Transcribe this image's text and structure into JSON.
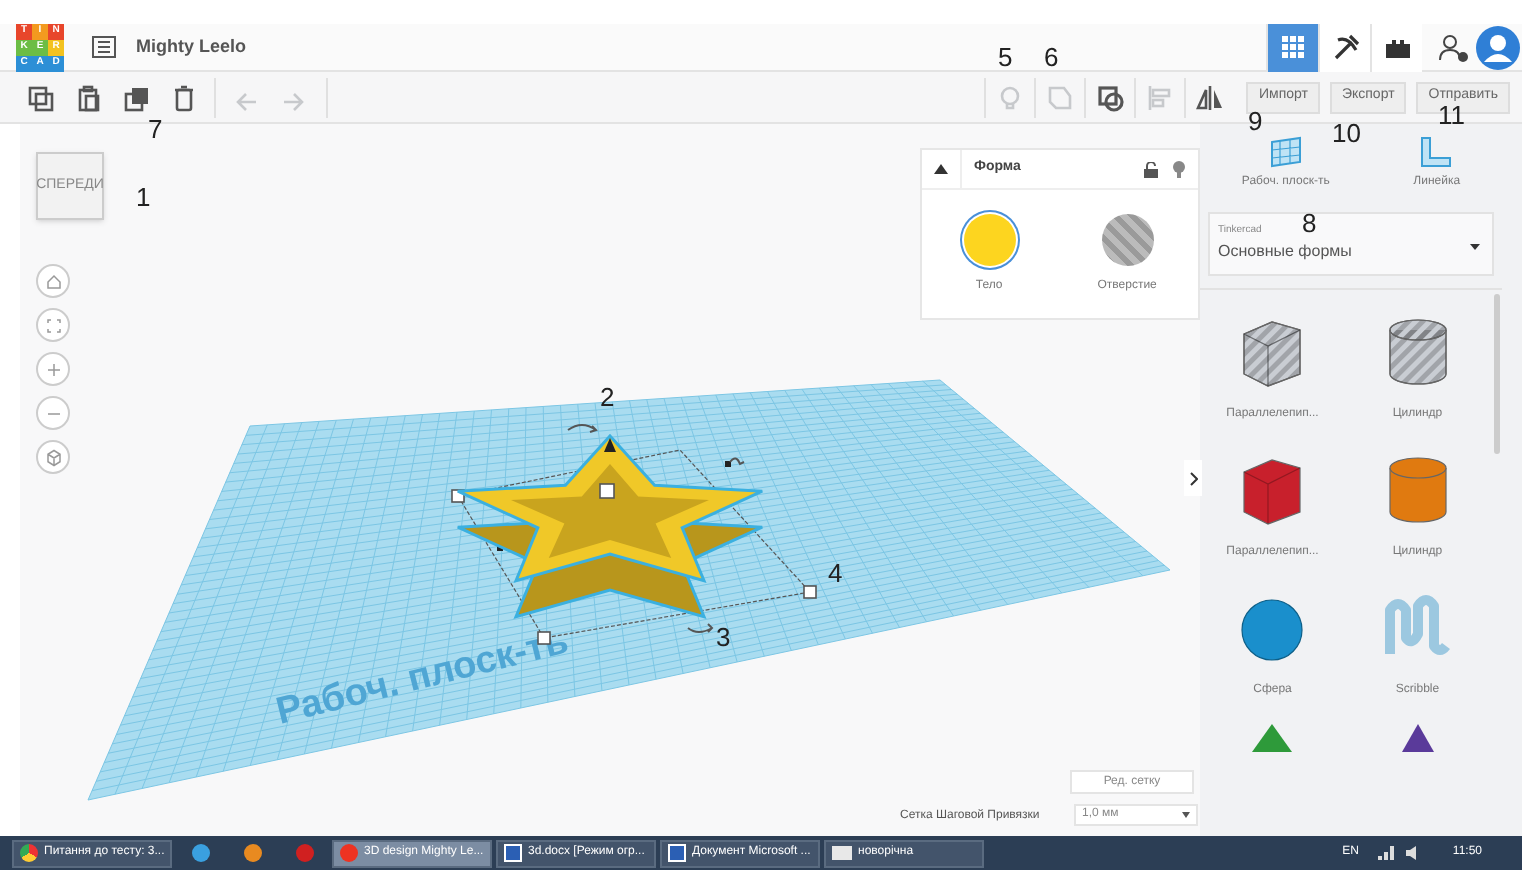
{
  "header": {
    "logo": [
      "T",
      "I",
      "N",
      "K",
      "E",
      "R",
      "C",
      "A",
      "D"
    ],
    "title": "Mighty Leelo",
    "nav": [
      {
        "kind": "grid",
        "selected": true
      },
      {
        "kind": "tools",
        "selected": false
      },
      {
        "kind": "bricks",
        "selected": false
      }
    ]
  },
  "toolbar": {
    "left": [
      {
        "kind": "copy",
        "disabled": false
      },
      {
        "kind": "paste",
        "disabled": false
      },
      {
        "kind": "duplicate",
        "disabled": false
      },
      {
        "kind": "delete",
        "disabled": false
      },
      {
        "kind": "undo",
        "disabled": true
      },
      {
        "kind": "redo",
        "disabled": true
      }
    ],
    "right": [
      {
        "kind": "light",
        "disabled": true
      },
      {
        "kind": "group",
        "disabled": true
      },
      {
        "kind": "ungroup",
        "disabled": false
      },
      {
        "kind": "align",
        "disabled": true
      },
      {
        "kind": "mirror",
        "disabled": false
      }
    ],
    "actions": [
      "Импорт",
      "Экспорт",
      "Отправить"
    ]
  },
  "view_cube": "СПЕРЕДИ",
  "nav_controls": [
    {
      "kind": "home"
    },
    {
      "kind": "fit"
    },
    {
      "kind": "zoom-in"
    },
    {
      "kind": "zoom-out"
    },
    {
      "kind": "perspective"
    }
  ],
  "inspector": {
    "title": "Форма",
    "expanded": true,
    "options": [
      {
        "kind": "solid",
        "label": "Тело",
        "selected": true
      },
      {
        "kind": "hole",
        "label": "Отверстие",
        "selected": false
      }
    ]
  },
  "workplane_label": "Рабоч. плоск-ть",
  "grid": {
    "edit_button": "Ред. сетку",
    "snap_label": "Сетка Шаговой Привязки",
    "snap_value": "1,0 мм"
  },
  "annotations": [
    "1",
    "2",
    "3",
    "4",
    "5",
    "6",
    "7",
    "8",
    "9",
    "10",
    "11"
  ],
  "panel": {
    "tools": [
      {
        "kind": "workplane",
        "label": "Рабоч. плоск-ть"
      },
      {
        "kind": "ruler",
        "label": "Линейка"
      }
    ],
    "library": {
      "source": "Tinkercad",
      "value": "Основные формы"
    },
    "shapes": [
      {
        "kind": "box",
        "label": "Параллелепип...",
        "color": "#c9cdd3",
        "hole": true
      },
      {
        "kind": "cylinder",
        "label": "Цилиндр",
        "color": "#c9cdd3",
        "hole": true
      },
      {
        "kind": "box",
        "label": "Параллелепип...",
        "color": "#c8202c",
        "hole": false
      },
      {
        "kind": "cylinder",
        "label": "Цилиндр",
        "color": "#e07a10",
        "hole": false
      },
      {
        "kind": "sphere",
        "label": "Сфера",
        "color": "#1a8fcc",
        "hole": false
      },
      {
        "kind": "scribble",
        "label": "Scribble",
        "color": "#9cc8e0",
        "hole": false
      },
      {
        "kind": "roof",
        "color": "#2e9a3a",
        "hole": false
      },
      {
        "kind": "pyramid",
        "color": "#5a3a9a",
        "hole": false
      }
    ]
  },
  "taskbar": {
    "items": [
      {
        "kind": "browser",
        "label": "Питання до тесту: 3...",
        "selected": false
      },
      {
        "kind": "app",
        "color": "#3aa0e0",
        "selected": false
      },
      {
        "kind": "app",
        "color": "#e88a20",
        "selected": false
      },
      {
        "kind": "app",
        "color": "#d02020",
        "selected": false
      },
      {
        "kind": "yandex",
        "label": "3D design Mighty Le...",
        "selected": true
      },
      {
        "kind": "word",
        "label": "3d.docx [Режим огр...",
        "selected": false
      },
      {
        "kind": "word",
        "label": "Документ Microsoft ...",
        "selected": false
      },
      {
        "kind": "folder",
        "label": "новорічна",
        "selected": false
      }
    ],
    "language": "EN",
    "time": "11:50"
  }
}
